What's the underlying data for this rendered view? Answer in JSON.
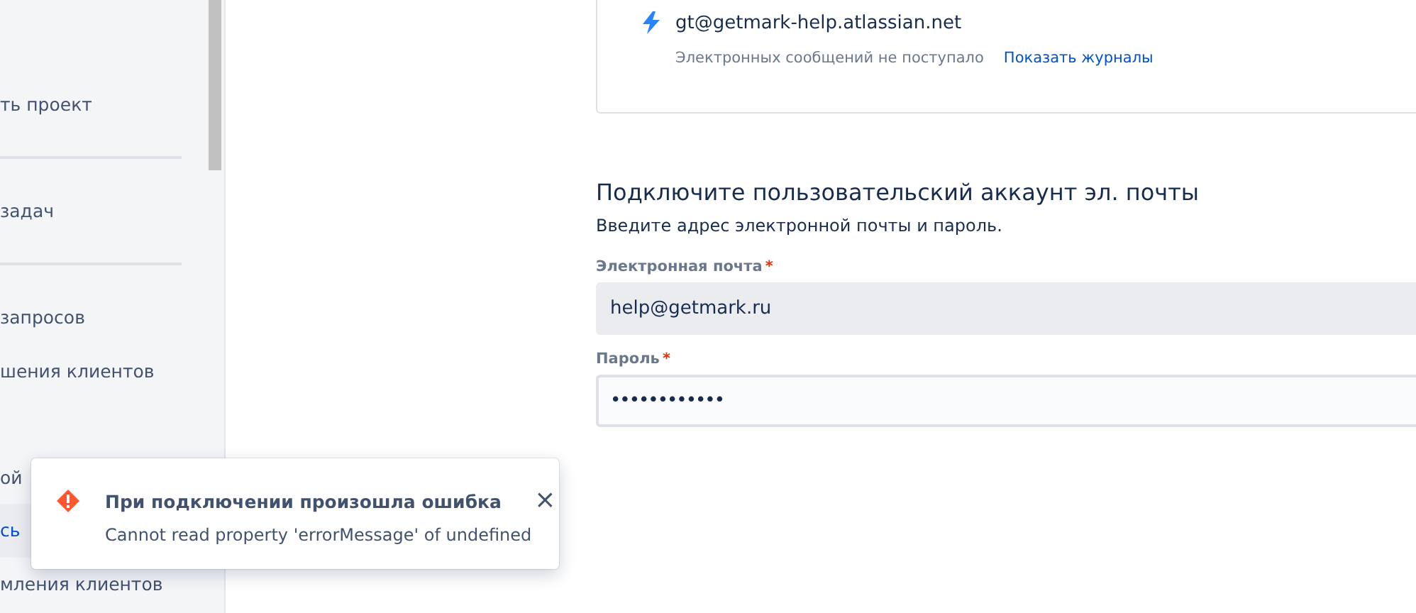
{
  "sidebar": {
    "groups": [
      {
        "items": [
          {
            "kind": "item",
            "label": "ть проект",
            "selected": false
          },
          {
            "kind": "divider"
          },
          {
            "kind": "item",
            "label": "задач",
            "selected": false
          },
          {
            "kind": "divider"
          },
          {
            "kind": "item",
            "label": "запросов",
            "selected": false
          },
          {
            "kind": "item",
            "label": "шения клиентов",
            "selected": false
          }
        ]
      },
      {
        "items": [
          {
            "kind": "item",
            "label": "ой",
            "selected": false
          },
          {
            "kind": "item",
            "label": "сь",
            "selected": true
          },
          {
            "kind": "item",
            "label": "мления клиентов",
            "selected": false
          }
        ]
      }
    ]
  },
  "mail_card": {
    "address": "gt@getmark-help.atlassian.net",
    "status": "Электронных сообщений не поступало",
    "link": "Показать журналы"
  },
  "connect_form": {
    "title": "Подключите пользовательский аккаунт эл. почты",
    "subtitle": "Введите адрес электронной почты и пароль.",
    "fields": [
      {
        "label": "Электронная почта",
        "required": "*",
        "value": "help@getmark.ru",
        "kind": "email",
        "disabled": true
      },
      {
        "label": "Пароль",
        "required": "*",
        "value": "••••••••••••",
        "kind": "password",
        "disabled": false
      }
    ]
  },
  "toast": {
    "title": "При подключении произошла ошибка",
    "message": "Cannot read property 'errorMessage' of undefined",
    "close": "×"
  }
}
